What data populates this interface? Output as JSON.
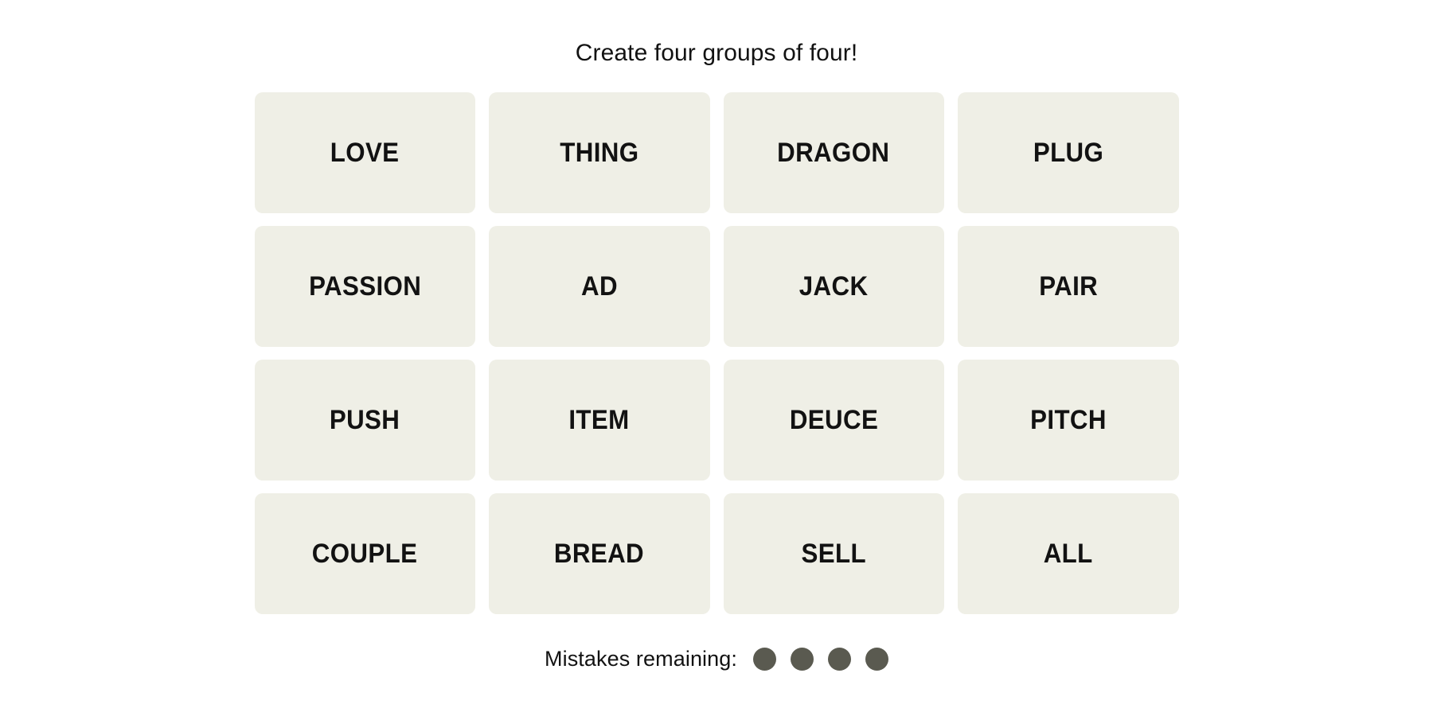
{
  "game": {
    "title": "Create four groups of four!",
    "tiles": [
      {
        "label": "LOVE"
      },
      {
        "label": "THING"
      },
      {
        "label": "DRAGON"
      },
      {
        "label": "PLUG"
      },
      {
        "label": "PASSION"
      },
      {
        "label": "AD"
      },
      {
        "label": "JACK"
      },
      {
        "label": "PAIR"
      },
      {
        "label": "PUSH"
      },
      {
        "label": "ITEM"
      },
      {
        "label": "DEUCE"
      },
      {
        "label": "PITCH"
      },
      {
        "label": "COUPLE"
      },
      {
        "label": "BREAD"
      },
      {
        "label": "SELL"
      },
      {
        "label": "ALL"
      }
    ],
    "mistakes": {
      "label": "Mistakes remaining:",
      "remaining": 4,
      "dots": [
        {
          "state": "filled"
        },
        {
          "state": "filled"
        },
        {
          "state": "filled"
        },
        {
          "state": "filled"
        }
      ]
    }
  },
  "colors": {
    "page_background": "#ffffff",
    "tile_background": "#efefe6",
    "tile_text": "#121212",
    "title_text": "#121212",
    "mistake_dot": "#5a5a50"
  }
}
